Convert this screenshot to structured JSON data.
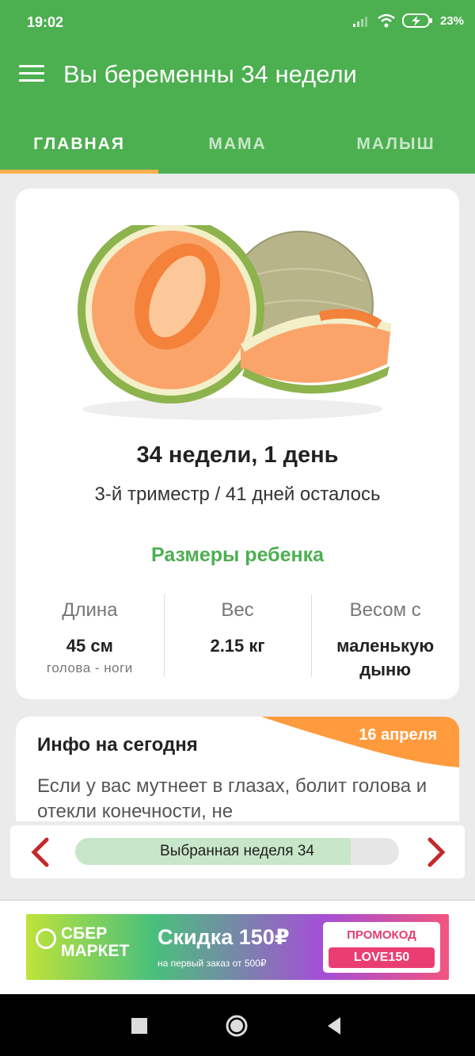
{
  "status": {
    "time": "19:02",
    "battery": "23%"
  },
  "appbar": {
    "title": "Вы беременны 34 недели"
  },
  "tabs": [
    "ГЛАВНАЯ",
    "МАМА",
    "МАЛЫШ"
  ],
  "card": {
    "week_day": "34 недели, 1 день",
    "trimester": "3-й триместр / 41 дней осталось",
    "sizes_title": "Размеры ребенка",
    "stats": [
      {
        "label": "Длина",
        "value": "45 см",
        "sub": "голова - ноги"
      },
      {
        "label": "Вес",
        "value": "2.15 кг",
        "sub": ""
      },
      {
        "label": "Весом с",
        "value": "маленькую дыню",
        "sub": ""
      }
    ]
  },
  "info": {
    "title": "Инфо на сегодня",
    "date": "16 апреля",
    "text": "Если у вас мутнеет в глазах, болит голова и отекли конечности, не"
  },
  "week_selector": {
    "label": "Выбранная неделя 34",
    "progress": 0.85
  },
  "ad": {
    "brand": "СБЕР МАРКЕТ",
    "brand_line1": "СБЕР",
    "brand_line2": "МАРКЕТ",
    "discount": "Скидка 150₽",
    "discount_sub": "на первый заказ от 500₽",
    "promo_label": "ПРОМОКОД",
    "promo_code": "LOVE150"
  },
  "colors": {
    "primary": "#4caf50",
    "accent": "#ffb04c",
    "orange": "#ff9b3d",
    "arrow": "#c62828"
  },
  "icons": [
    "menu-icon",
    "signal-icon",
    "wifi-icon",
    "battery-icon",
    "chevron-left-icon",
    "chevron-right-icon",
    "nav-square-icon",
    "nav-circle-icon",
    "nav-back-icon"
  ]
}
